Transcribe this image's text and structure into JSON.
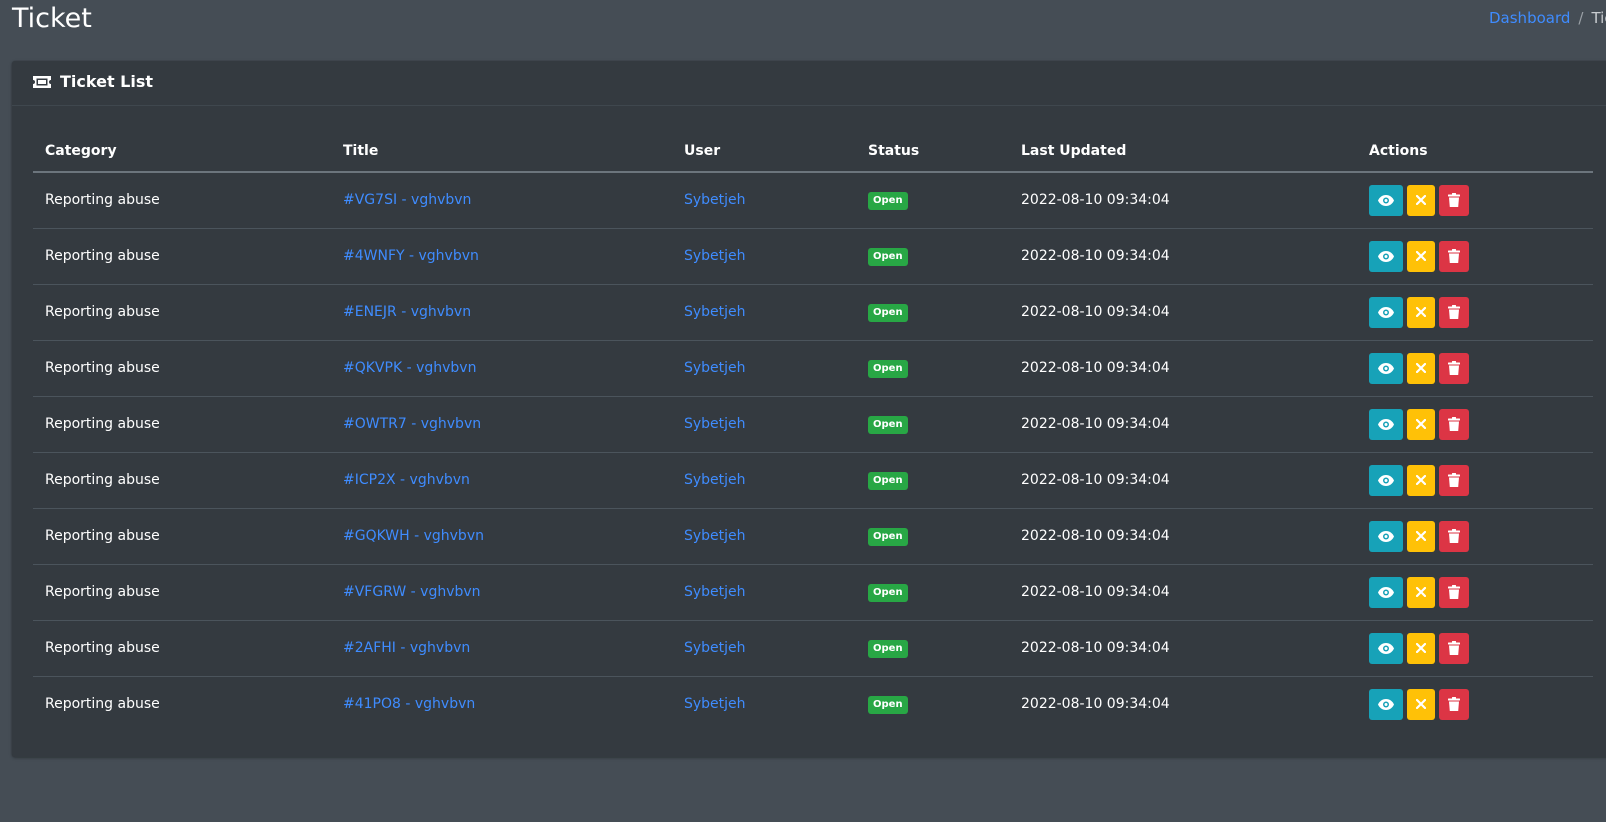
{
  "page": {
    "title": "Ticket",
    "breadcrumb": {
      "home": "Dashboard",
      "separator": "/",
      "current": "Tick"
    }
  },
  "card": {
    "title": "Ticket List",
    "icon": "ticket-icon"
  },
  "table": {
    "headers": {
      "category": "Category",
      "title": "Title",
      "user": "User",
      "status": "Status",
      "last_updated": "Last Updated",
      "actions": "Actions"
    },
    "rows": [
      {
        "category": "Reporting abuse",
        "title": "#VG7SI - vghvbvn",
        "user": "Sybetjeh",
        "status": "Open",
        "last_updated": "2022-08-10 09:34:04"
      },
      {
        "category": "Reporting abuse",
        "title": "#4WNFY - vghvbvn",
        "user": "Sybetjeh",
        "status": "Open",
        "last_updated": "2022-08-10 09:34:04"
      },
      {
        "category": "Reporting abuse",
        "title": "#ENEJR - vghvbvn",
        "user": "Sybetjeh",
        "status": "Open",
        "last_updated": "2022-08-10 09:34:04"
      },
      {
        "category": "Reporting abuse",
        "title": "#QKVPK - vghvbvn",
        "user": "Sybetjeh",
        "status": "Open",
        "last_updated": "2022-08-10 09:34:04"
      },
      {
        "category": "Reporting abuse",
        "title": "#OWTR7 - vghvbvn",
        "user": "Sybetjeh",
        "status": "Open",
        "last_updated": "2022-08-10 09:34:04"
      },
      {
        "category": "Reporting abuse",
        "title": "#ICP2X - vghvbvn",
        "user": "Sybetjeh",
        "status": "Open",
        "last_updated": "2022-08-10 09:34:04"
      },
      {
        "category": "Reporting abuse",
        "title": "#GQKWH - vghvbvn",
        "user": "Sybetjeh",
        "status": "Open",
        "last_updated": "2022-08-10 09:34:04"
      },
      {
        "category": "Reporting abuse",
        "title": "#VFGRW - vghvbvn",
        "user": "Sybetjeh",
        "status": "Open",
        "last_updated": "2022-08-10 09:34:04"
      },
      {
        "category": "Reporting abuse",
        "title": "#2AFHI - vghvbvn",
        "user": "Sybetjeh",
        "status": "Open",
        "last_updated": "2022-08-10 09:34:04"
      },
      {
        "category": "Reporting abuse",
        "title": "#41PO8 - vghvbvn",
        "user": "Sybetjeh",
        "status": "Open",
        "last_updated": "2022-08-10 09:34:04"
      }
    ],
    "action_icons": [
      "eye-icon",
      "close-icon",
      "trash-icon"
    ]
  },
  "colors": {
    "background": "#454d55",
    "card": "#343a40",
    "link": "#3f8cff",
    "badge_open": "#28a745",
    "btn_view": "#17a2b8",
    "btn_close": "#ffc107",
    "btn_delete": "#dc3545"
  }
}
